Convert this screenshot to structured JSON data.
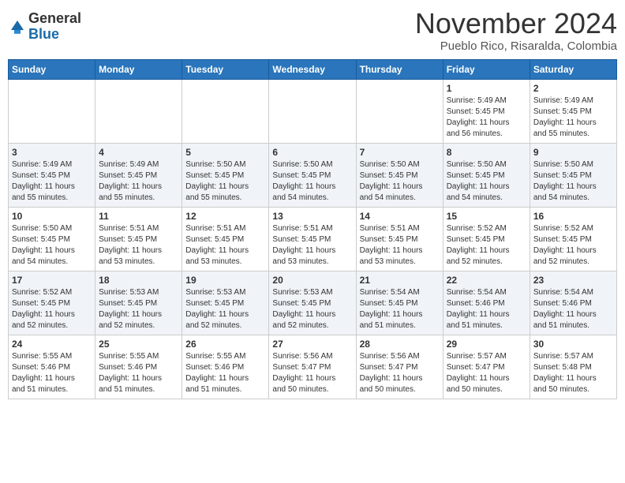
{
  "header": {
    "logo_general": "General",
    "logo_blue": "Blue",
    "month_title": "November 2024",
    "location": "Pueblo Rico, Risaralda, Colombia"
  },
  "weekdays": [
    "Sunday",
    "Monday",
    "Tuesday",
    "Wednesday",
    "Thursday",
    "Friday",
    "Saturday"
  ],
  "weeks": [
    [
      {
        "day": "",
        "info": ""
      },
      {
        "day": "",
        "info": ""
      },
      {
        "day": "",
        "info": ""
      },
      {
        "day": "",
        "info": ""
      },
      {
        "day": "",
        "info": ""
      },
      {
        "day": "1",
        "info": "Sunrise: 5:49 AM\nSunset: 5:45 PM\nDaylight: 11 hours\nand 56 minutes."
      },
      {
        "day": "2",
        "info": "Sunrise: 5:49 AM\nSunset: 5:45 PM\nDaylight: 11 hours\nand 55 minutes."
      }
    ],
    [
      {
        "day": "3",
        "info": "Sunrise: 5:49 AM\nSunset: 5:45 PM\nDaylight: 11 hours\nand 55 minutes."
      },
      {
        "day": "4",
        "info": "Sunrise: 5:49 AM\nSunset: 5:45 PM\nDaylight: 11 hours\nand 55 minutes."
      },
      {
        "day": "5",
        "info": "Sunrise: 5:50 AM\nSunset: 5:45 PM\nDaylight: 11 hours\nand 55 minutes."
      },
      {
        "day": "6",
        "info": "Sunrise: 5:50 AM\nSunset: 5:45 PM\nDaylight: 11 hours\nand 54 minutes."
      },
      {
        "day": "7",
        "info": "Sunrise: 5:50 AM\nSunset: 5:45 PM\nDaylight: 11 hours\nand 54 minutes."
      },
      {
        "day": "8",
        "info": "Sunrise: 5:50 AM\nSunset: 5:45 PM\nDaylight: 11 hours\nand 54 minutes."
      },
      {
        "day": "9",
        "info": "Sunrise: 5:50 AM\nSunset: 5:45 PM\nDaylight: 11 hours\nand 54 minutes."
      }
    ],
    [
      {
        "day": "10",
        "info": "Sunrise: 5:50 AM\nSunset: 5:45 PM\nDaylight: 11 hours\nand 54 minutes."
      },
      {
        "day": "11",
        "info": "Sunrise: 5:51 AM\nSunset: 5:45 PM\nDaylight: 11 hours\nand 53 minutes."
      },
      {
        "day": "12",
        "info": "Sunrise: 5:51 AM\nSunset: 5:45 PM\nDaylight: 11 hours\nand 53 minutes."
      },
      {
        "day": "13",
        "info": "Sunrise: 5:51 AM\nSunset: 5:45 PM\nDaylight: 11 hours\nand 53 minutes."
      },
      {
        "day": "14",
        "info": "Sunrise: 5:51 AM\nSunset: 5:45 PM\nDaylight: 11 hours\nand 53 minutes."
      },
      {
        "day": "15",
        "info": "Sunrise: 5:52 AM\nSunset: 5:45 PM\nDaylight: 11 hours\nand 52 minutes."
      },
      {
        "day": "16",
        "info": "Sunrise: 5:52 AM\nSunset: 5:45 PM\nDaylight: 11 hours\nand 52 minutes."
      }
    ],
    [
      {
        "day": "17",
        "info": "Sunrise: 5:52 AM\nSunset: 5:45 PM\nDaylight: 11 hours\nand 52 minutes."
      },
      {
        "day": "18",
        "info": "Sunrise: 5:53 AM\nSunset: 5:45 PM\nDaylight: 11 hours\nand 52 minutes."
      },
      {
        "day": "19",
        "info": "Sunrise: 5:53 AM\nSunset: 5:45 PM\nDaylight: 11 hours\nand 52 minutes."
      },
      {
        "day": "20",
        "info": "Sunrise: 5:53 AM\nSunset: 5:45 PM\nDaylight: 11 hours\nand 52 minutes."
      },
      {
        "day": "21",
        "info": "Sunrise: 5:54 AM\nSunset: 5:45 PM\nDaylight: 11 hours\nand 51 minutes."
      },
      {
        "day": "22",
        "info": "Sunrise: 5:54 AM\nSunset: 5:46 PM\nDaylight: 11 hours\nand 51 minutes."
      },
      {
        "day": "23",
        "info": "Sunrise: 5:54 AM\nSunset: 5:46 PM\nDaylight: 11 hours\nand 51 minutes."
      }
    ],
    [
      {
        "day": "24",
        "info": "Sunrise: 5:55 AM\nSunset: 5:46 PM\nDaylight: 11 hours\nand 51 minutes."
      },
      {
        "day": "25",
        "info": "Sunrise: 5:55 AM\nSunset: 5:46 PM\nDaylight: 11 hours\nand 51 minutes."
      },
      {
        "day": "26",
        "info": "Sunrise: 5:55 AM\nSunset: 5:46 PM\nDaylight: 11 hours\nand 51 minutes."
      },
      {
        "day": "27",
        "info": "Sunrise: 5:56 AM\nSunset: 5:47 PM\nDaylight: 11 hours\nand 50 minutes."
      },
      {
        "day": "28",
        "info": "Sunrise: 5:56 AM\nSunset: 5:47 PM\nDaylight: 11 hours\nand 50 minutes."
      },
      {
        "day": "29",
        "info": "Sunrise: 5:57 AM\nSunset: 5:47 PM\nDaylight: 11 hours\nand 50 minutes."
      },
      {
        "day": "30",
        "info": "Sunrise: 5:57 AM\nSunset: 5:48 PM\nDaylight: 11 hours\nand 50 minutes."
      }
    ]
  ]
}
